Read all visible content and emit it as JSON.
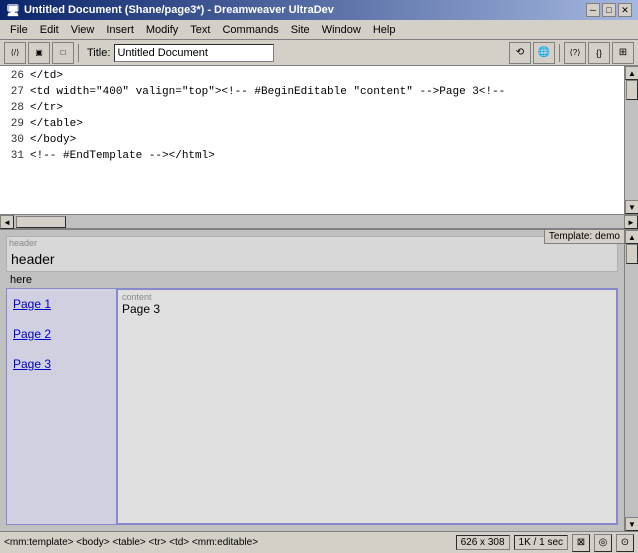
{
  "titlebar": {
    "title": "Untitled Document (Shane/page3*) - Dreamweaver UltraDev",
    "minimize": "─",
    "maximize": "□",
    "close": "✕"
  },
  "menubar": {
    "items": [
      "File",
      "Edit",
      "View",
      "Insert",
      "Modify",
      "Text",
      "Commands",
      "Site",
      "Window",
      "Help"
    ]
  },
  "toolbar": {
    "title_label": "Title:",
    "title_value": "Untitled Document"
  },
  "code": {
    "lines": [
      {
        "num": "26",
        "text": "</td>"
      },
      {
        "num": "27",
        "text": "<td width=\"400\" valign=\"top\"><!-- #BeginEditable \"content\" -->Page 3<!--"
      },
      {
        "num": "28",
        "text": "</tr>"
      },
      {
        "num": "29",
        "text": "</table>"
      },
      {
        "num": "30",
        "text": "</body>"
      },
      {
        "num": "31",
        "text": "<!-- #EndTemplate --></html>"
      }
    ]
  },
  "template_label": "Template: demo",
  "design": {
    "header_label": "header",
    "header_text": "header",
    "here_text": "here",
    "content_label": "content",
    "content_text": "Page 3",
    "links": [
      "Page 1",
      "Page 2",
      "Page 3"
    ]
  },
  "statusbar": {
    "path": "<mm:template> <body> <table> <tr> <td> <mm:editable>",
    "size": "626 x 308",
    "speed": "1K / 1 sec"
  }
}
